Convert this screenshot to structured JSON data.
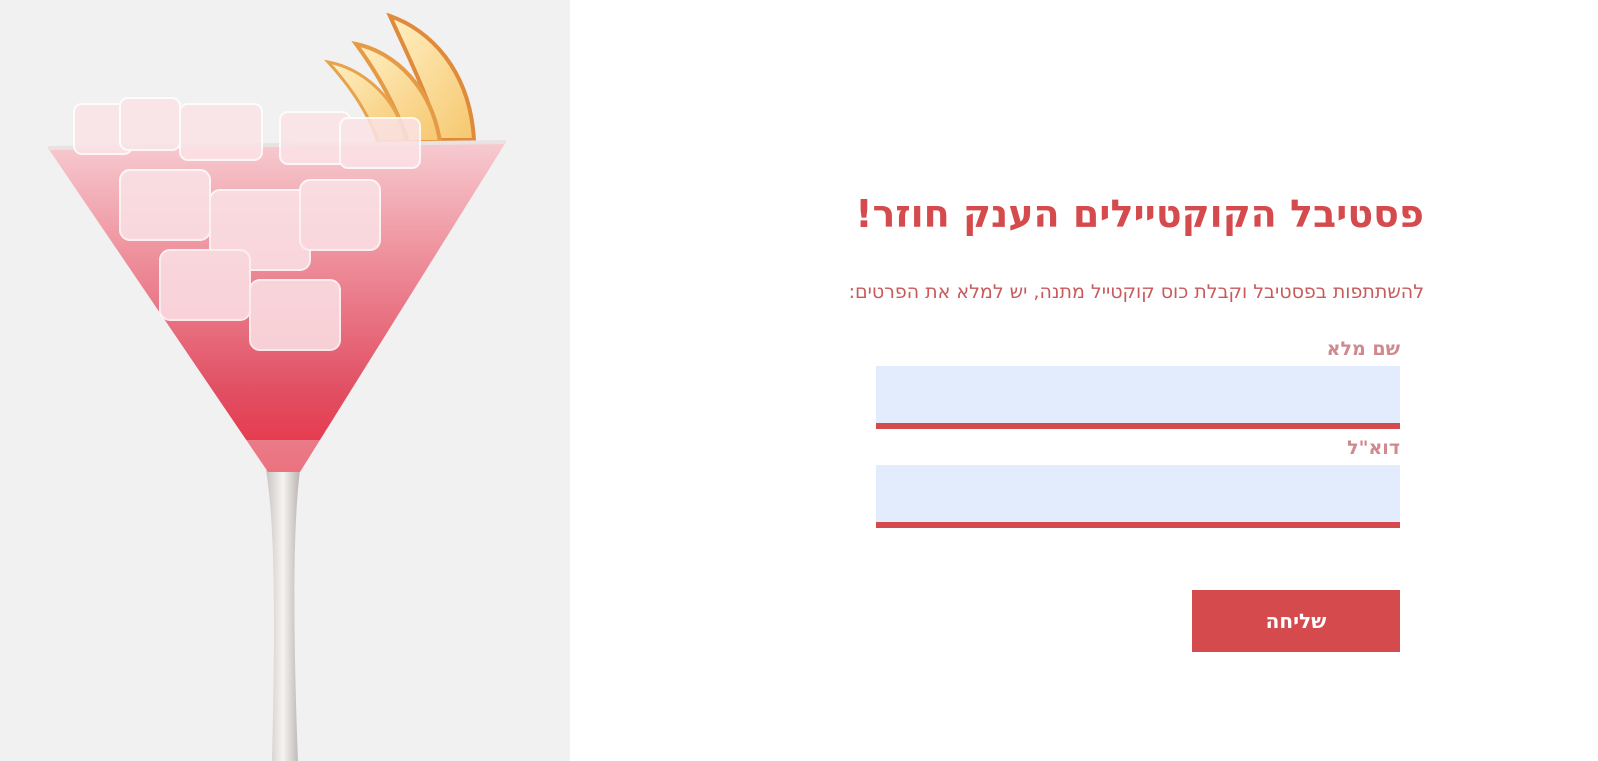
{
  "form": {
    "title": "פסטיבל הקוקטיילים הענק חוזר!",
    "subtitle": "להשתתפות בפסטיבל וקבלת כוס קוקטייל מתנה, יש למלא את הפרטים:",
    "full_name": {
      "label": "שם מלא",
      "value": "",
      "placeholder": ""
    },
    "email": {
      "label": "דוא\"ל",
      "value": "",
      "placeholder": ""
    },
    "submit_label": "שליחה"
  },
  "image": {
    "icon": "cocktail-glass-photo"
  },
  "colors": {
    "accent": "#d54a4d",
    "label": "#cf8a8f",
    "input_bg": "#e3ecfd",
    "panel_bg": "#f1f1f1"
  }
}
